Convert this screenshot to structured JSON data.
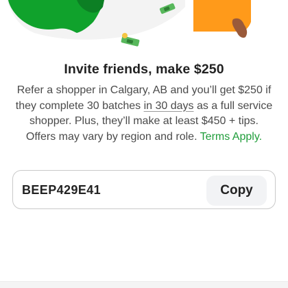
{
  "referral": {
    "title": "Invite friends, make $250",
    "description_before": "Refer a shopper in Calgary, AB and you’ll get $250 if they complete 30 batches ",
    "description_underlined": "in 30 days",
    "description_after": " as a full service shopper. Plus, they’ll make at least $450 + tips. Offers may vary by region and role. ",
    "terms_link": "Terms Apply."
  },
  "code": {
    "value": "BEEP429E41",
    "copy_label": "Copy"
  },
  "colors": {
    "brand_green": "#1f9d3a",
    "accent_orange": "#ff9a1a",
    "text_dark": "#222222",
    "text_body": "#4a4a4a",
    "button_bg": "#f2f3f5"
  },
  "icons": [
    "money-bill-icon"
  ]
}
